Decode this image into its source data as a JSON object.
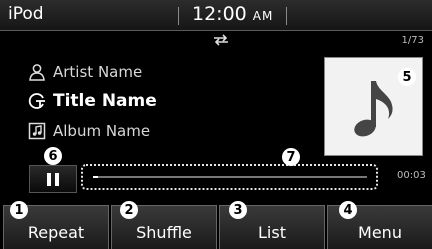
{
  "status_bar": {
    "source": "iPod",
    "time": "12:00",
    "ampm": "AM"
  },
  "info_bar": {
    "repeat_icon": "repeat-shuffle-icon",
    "track_counter": "1/73"
  },
  "track": {
    "artist": "Artist Name",
    "title": "Title Name",
    "album": "Album Name",
    "artist_icon": "person-icon",
    "title_icon": "title-icon",
    "album_icon": "album-icon"
  },
  "album_art": {
    "icon": "music-note-icon"
  },
  "playback": {
    "control_icon": "pause-icon",
    "elapsed": "00:03",
    "progress": 0.02
  },
  "buttons": [
    {
      "label": "Repeat",
      "callout": "1"
    },
    {
      "label": "Shuffle",
      "callout": "2"
    },
    {
      "label": "List",
      "callout": "3"
    },
    {
      "label": "Menu",
      "callout": "4"
    }
  ],
  "callouts": {
    "album_art": "5",
    "pause": "6",
    "progress": "7"
  },
  "colors": {
    "screen_bg": "#000000",
    "text": "#ffffff",
    "album_art_bg": "#f2f2f2"
  }
}
